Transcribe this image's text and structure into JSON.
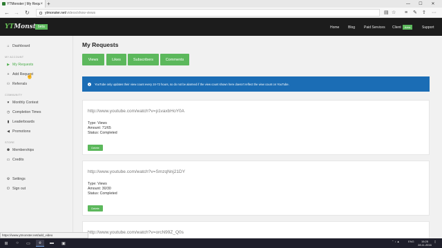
{
  "browser": {
    "tab_title": "YTMonster | My Reques",
    "tab_close": "×",
    "new_tab": "+",
    "window_controls": [
      "—",
      "☐",
      "✕"
    ],
    "url_host": "ytmonster.net",
    "url_path": "/videos/show-views",
    "nav_back": "←",
    "nav_forward": "→",
    "nav_reload": "↻",
    "status_url": "https://www.ytmonster.net/add_video",
    "tool_icons": [
      "reading-view-icon",
      "favorites-star-icon",
      "hub-icon",
      "pen-icon",
      "share-icon",
      "more-icon"
    ]
  },
  "header": {
    "logo_prefix": "YT",
    "logo_suffix": "Monster",
    "beta": "beta",
    "nav": [
      "Home",
      "Blog",
      "Paid Services",
      "Client",
      "Support"
    ],
    "client_badge": "Area"
  },
  "sidebar": {
    "dashboard": "Dashboard",
    "section_account": "MY ACCOUNT",
    "my_requests": "My Requests",
    "add_request": "Add Request",
    "referrals": "Referrals",
    "section_community": "COMMUNITY",
    "monthly_contest": "Monthly Contest",
    "completion_times": "Completion Times",
    "leaderboards": "Leaderboards",
    "promotions": "Promotions",
    "section_store": "STORE",
    "memberships": "Memberships",
    "credits": "Credits",
    "settings": "Settings",
    "sign_out": "Sign out"
  },
  "main": {
    "title": "My Requests",
    "filters": [
      "Views",
      "Likes",
      "Subscribers",
      "Comments"
    ],
    "info": "YouTube only updates their view count every 24-72 hours, so do not be alarmed if the view count shown here doesn't reflect the view count on YouTube.",
    "delete_label": "Delete",
    "requests": [
      {
        "url": "http://www.youtube.com/watch?v=p1vaxbHoY0A",
        "type": "Type: Views",
        "amount": "Amount: 71/65",
        "status": "Status: Completed"
      },
      {
        "url": "http://www.youtube.com/watch?v=SmzqNnj21DY",
        "type": "Type: Views",
        "amount": "Amount: 30/30",
        "status": "Status: Completed"
      },
      {
        "url": "http://www.youtube.com/watch?v=orcN99Z_Q0s"
      }
    ]
  },
  "taskbar": {
    "tray": "ENG",
    "time": "15:25",
    "date": "28.11.2016"
  }
}
